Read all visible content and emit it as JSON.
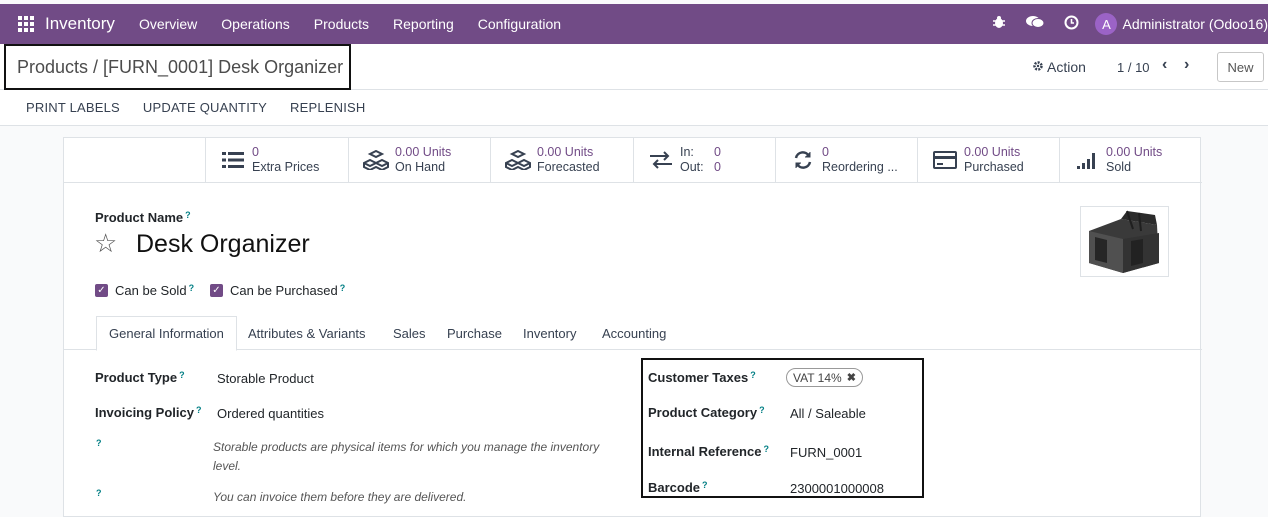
{
  "navbar": {
    "app_title": "Inventory",
    "menu": [
      "Overview",
      "Operations",
      "Products",
      "Reporting",
      "Configuration"
    ],
    "user_initial": "A",
    "user_name": "Administrator (Odoo16)"
  },
  "control": {
    "breadcrumb": "Products / [FURN_0001] Desk Organizer",
    "action_label": "Action",
    "pager": "1 / 10",
    "new_label": "New"
  },
  "statusbar": {
    "buttons": [
      "PRINT LABELS",
      "UPDATE QUANTITY",
      "REPLENISH"
    ]
  },
  "smart_buttons": [
    {
      "value": "0",
      "label": "Extra Prices",
      "icon": "list-icon"
    },
    {
      "value": "0.00 Units",
      "label": "On Hand",
      "icon": "cubes-icon"
    },
    {
      "value": "0.00 Units",
      "label": "Forecasted",
      "icon": "cubes-icon"
    },
    {
      "in_label": "In:",
      "in_value": "0",
      "out_label": "Out:",
      "out_value": "0",
      "icon": "exchange-icon"
    },
    {
      "value": "0",
      "label": "Reordering ...",
      "icon": "refresh-icon"
    },
    {
      "value": "0.00 Units",
      "label": "Purchased",
      "icon": "credit-card-icon"
    },
    {
      "value": "0.00 Units",
      "label": "Sold",
      "icon": "signal-icon"
    }
  ],
  "product": {
    "name_label": "Product Name",
    "name": "Desk Organizer",
    "can_be_sold": "Can be Sold",
    "can_be_purchased": "Can be Purchased"
  },
  "tabs": [
    "General Information",
    "Attributes & Variants",
    "Sales",
    "Purchase",
    "Inventory",
    "Accounting"
  ],
  "general": {
    "product_type_label": "Product Type",
    "product_type": "Storable Product",
    "invoicing_policy_label": "Invoicing Policy",
    "invoicing_policy": "Ordered quantities",
    "help_storable": "Storable products are physical items for which you manage the inventory level.",
    "help_invoice": "You can invoice them before they are delivered.",
    "customer_taxes_label": "Customer Taxes",
    "customer_tax_tag": "VAT 14%",
    "product_category_label": "Product Category",
    "product_category": "All / Saleable",
    "internal_reference_label": "Internal Reference",
    "internal_reference": "FURN_0001",
    "barcode_label": "Barcode",
    "barcode": "2300001000008"
  },
  "colors": {
    "brand": "#714b86",
    "link": "#017e84"
  }
}
